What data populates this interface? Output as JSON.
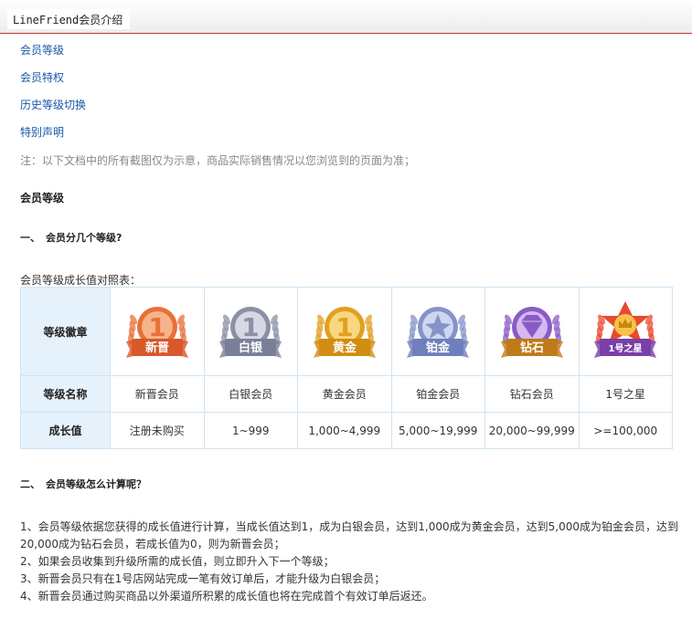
{
  "header": {
    "title": "LineFriend会员介绍"
  },
  "nav": [
    {
      "label": "会员等级"
    },
    {
      "label": "会员特权"
    },
    {
      "label": "历史等级切换"
    },
    {
      "label": "特别声明"
    }
  ],
  "note": "注：以下文档中的所有截图仅为示意，商品实际销售情况以您浏览到的页面为准；",
  "section_title": "会员等级",
  "q1": {
    "num": "一、",
    "text": "会员分几个等级?"
  },
  "table_caption": "会员等级成长值对照表：",
  "table": {
    "row_headers": [
      "等级徽章",
      "等级名称",
      "成长值"
    ],
    "levels": [
      {
        "badge_text": "新晋",
        "name": "新晋会员",
        "growth": "注册未购买",
        "color_main": "#e8703a",
        "color_light": "#f7b38a",
        "ribbon": "#d8582a",
        "emblem": "1"
      },
      {
        "badge_text": "白银",
        "name": "白银会员",
        "growth": "1~999",
        "color_main": "#8c90a6",
        "color_light": "#d6d8e4",
        "ribbon": "#7a7f99",
        "emblem": "1"
      },
      {
        "badge_text": "黄金",
        "name": "黄金会员",
        "growth": "1,000~4,999",
        "color_main": "#e0a021",
        "color_light": "#f8d77e",
        "ribbon": "#d18d12",
        "emblem": "1"
      },
      {
        "badge_text": "铂金",
        "name": "铂金会员",
        "growth": "5,000~19,999",
        "color_main": "#8593c8",
        "color_light": "#cfd6f0",
        "ribbon": "#6f7fbd",
        "emblem": "star"
      },
      {
        "badge_text": "钻石",
        "name": "钻石会员",
        "growth": "20,000~99,999",
        "color_main": "#8a5bc6",
        "color_light": "#d3b8f2",
        "ribbon": "#c07a1a",
        "emblem": "diamond"
      },
      {
        "badge_text": "1号之星",
        "name": "1号之星",
        "growth": ">=100,000",
        "color_main": "#e84a2c",
        "color_light": "#f8c24a",
        "ribbon": "#7a3fa8",
        "emblem": "crown"
      }
    ]
  },
  "q2": {
    "num": "二、",
    "text": "会员等级怎么计算呢？"
  },
  "rules": [
    "1、会员等级依据您获得的成长值进行计算，当成长值达到1，成为白银会员，达到1,000成为黄金会员，达到5,000成为铂金会员，达到20,000成为钻石会员，若成长值为0，则为新晋会员；",
    "2、如果会员收集到升级所需的成长值，则立即升入下一个等级；",
    "3、新晋会员只有在1号店网站完成一笔有效订单后，才能升级为白银会员；",
    "4、新晋会员通过购买商品以外渠道所积累的成长值也将在完成首个有效订单后返还。"
  ]
}
